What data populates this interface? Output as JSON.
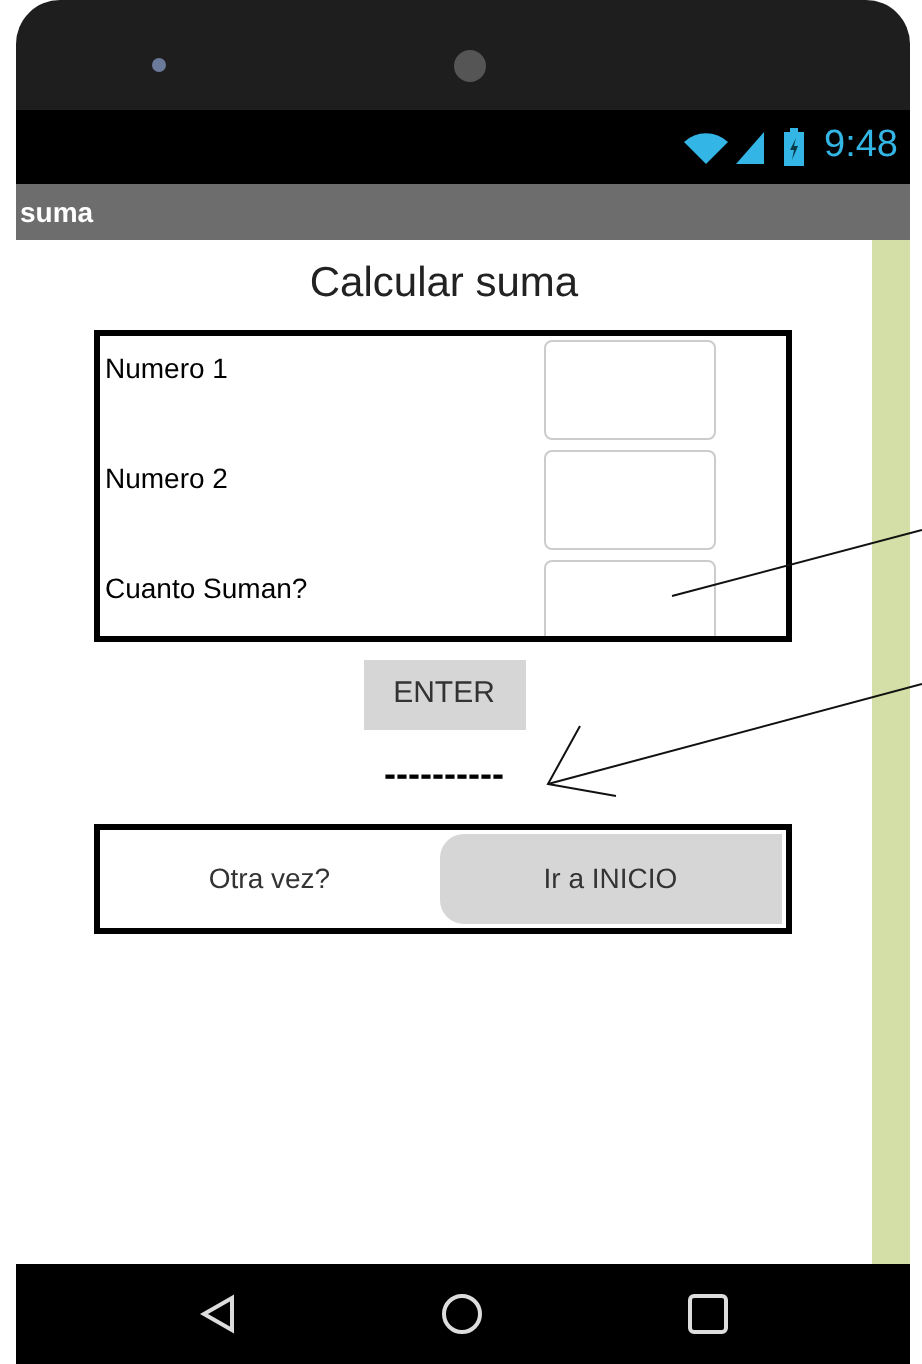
{
  "status_bar": {
    "time": "9:48"
  },
  "app_bar": {
    "title": "suma"
  },
  "heading": "Calcular suma",
  "form": [
    {
      "label": "Numero 1"
    },
    {
      "label": "Numero 2"
    },
    {
      "label": "Cuanto Suman?"
    }
  ],
  "enter_button": "ENTER",
  "result": "----------",
  "actions": [
    {
      "label": "Otra vez?",
      "kind": "plain"
    },
    {
      "label": "Ir a INICIO",
      "kind": "filled"
    }
  ]
}
